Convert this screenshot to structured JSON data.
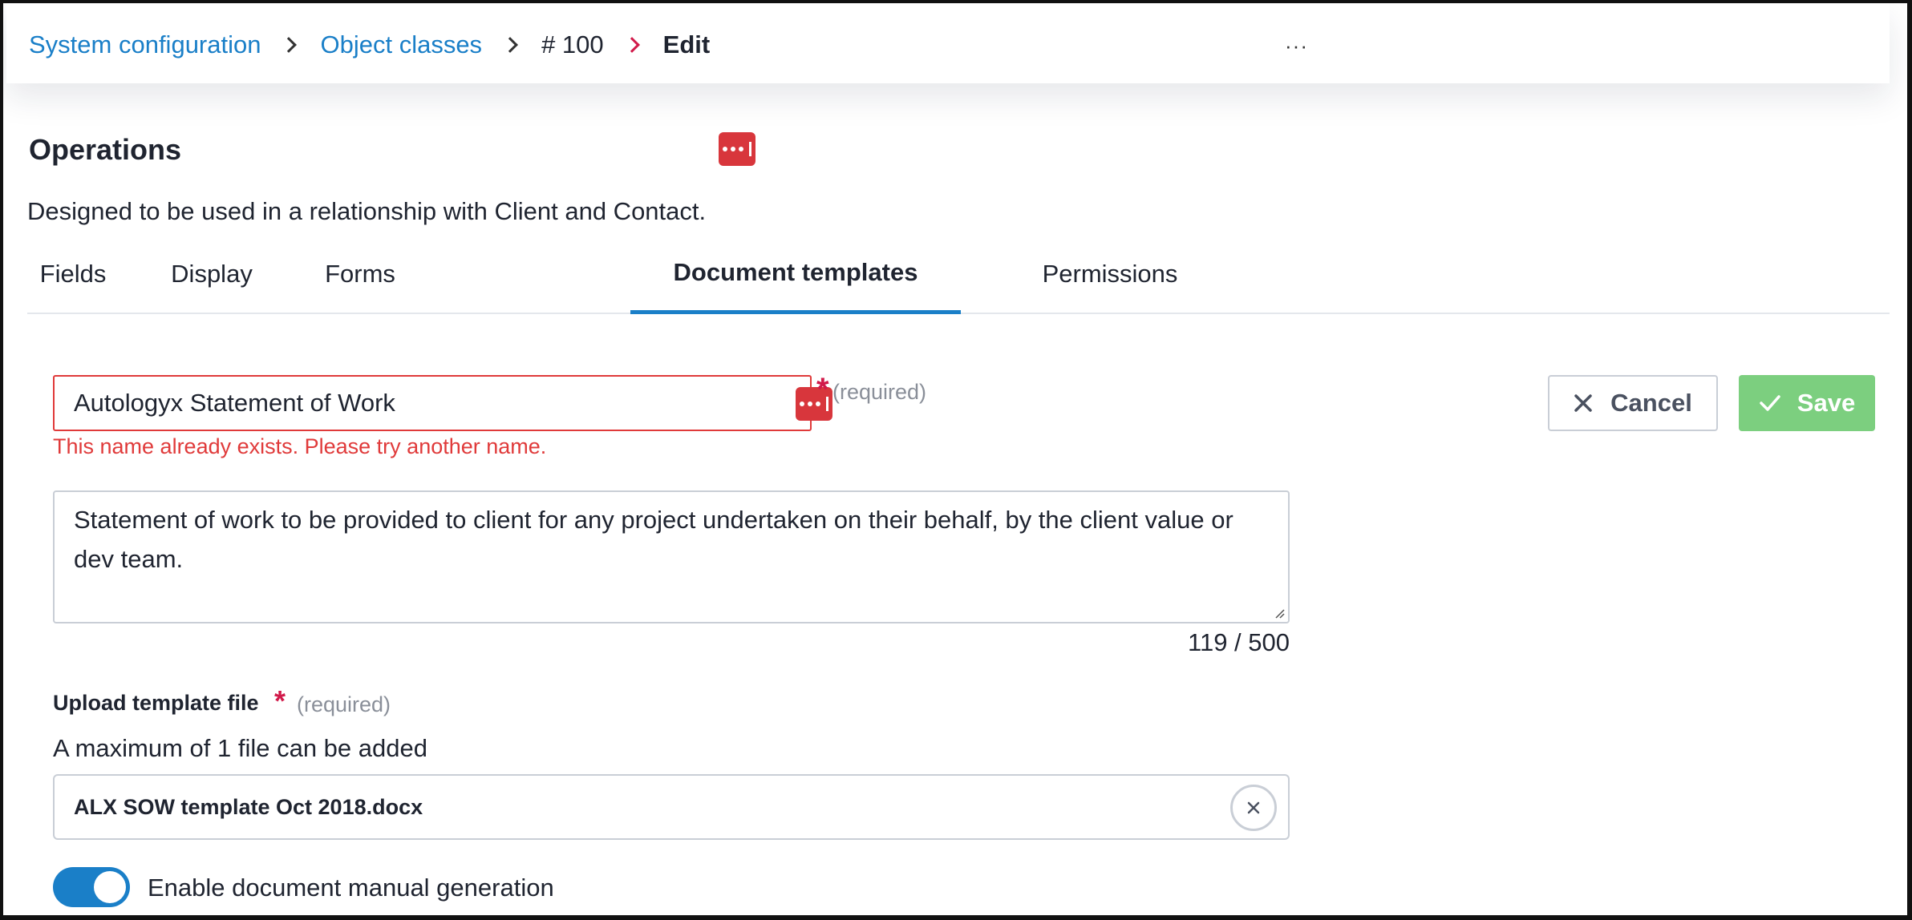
{
  "breadcrumb": {
    "items": [
      "System configuration",
      "Object classes",
      "# 100"
    ],
    "current": "Edit",
    "more": "···"
  },
  "page": {
    "title": "Operations",
    "subtitle": "Designed to be used in a relationship with Client and Contact."
  },
  "tabs": [
    {
      "label": "Fields"
    },
    {
      "label": "Display"
    },
    {
      "label": "Forms"
    },
    {
      "label": "Document templates",
      "active": true
    },
    {
      "label": "Permissions"
    }
  ],
  "form": {
    "name_value": "Autologyx Statement of Work",
    "required_text": "(required)",
    "error": "This name already exists. Please try another name.",
    "description": "Statement of work to be provided to client for any project undertaken on their behalf, by the client value or dev team.",
    "counter": "119 / 500",
    "upload_label": "Upload template file",
    "upload_required": "(required)",
    "upload_hint": "A maximum of 1 file can be added",
    "file_name": "ALX SOW template Oct 2018.docx",
    "toggle_label": "Enable document manual generation",
    "toggle_on": true
  },
  "actions": {
    "cancel": "Cancel",
    "save": "Save"
  },
  "colors": {
    "link": "#1a7fc8",
    "error": "#e03a3a",
    "required": "#d11a4a",
    "save": "#7ccf7f",
    "badge": "#d8363c"
  },
  "icons": [
    "chevron-right-icon",
    "more-icon",
    "password-manager-icon",
    "close-icon",
    "check-icon",
    "remove-file-icon"
  ]
}
